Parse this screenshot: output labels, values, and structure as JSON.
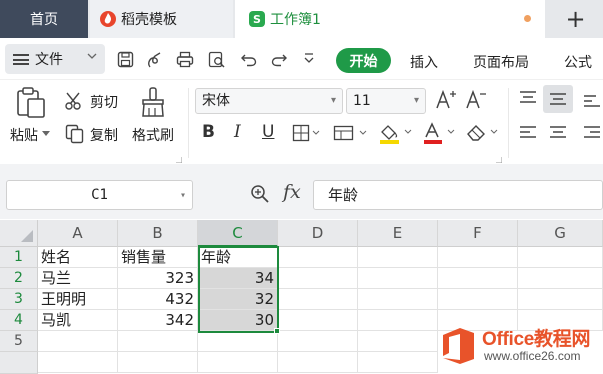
{
  "tabs": {
    "home": "首页",
    "template": "稻壳模板",
    "workbook": "工作簿1",
    "workbook_icon_text": "S",
    "new_tab": "+"
  },
  "menu": {
    "file": "文件",
    "start": "开始",
    "insert": "插入",
    "page_layout": "页面布局",
    "formula": "公式"
  },
  "ribbon": {
    "paste": "粘贴",
    "cut": "剪切",
    "copy": "复制",
    "format_painter": "格式刷",
    "font_name": "宋体",
    "font_size": "11"
  },
  "formula_bar": {
    "cell_ref": "C1",
    "fx": "fx",
    "content": "年龄"
  },
  "sheet": {
    "columns": [
      "A",
      "B",
      "C",
      "D",
      "E",
      "F",
      "G"
    ],
    "selected_column": "C",
    "rows": [
      "1",
      "2",
      "3",
      "4",
      "5"
    ],
    "cells": [
      [
        "姓名",
        "销售量",
        "年龄"
      ],
      [
        "马兰",
        "323",
        "34"
      ],
      [
        "王明明",
        "432",
        "32"
      ],
      [
        "马凯",
        "342",
        "30"
      ]
    ],
    "selected_range": "C1:C4"
  },
  "watermark": {
    "title": "Office教程网",
    "url": "www.office26.com"
  },
  "colors": {
    "accent_green": "#1f9a48",
    "tab_home_bg": "#3f4a5c",
    "selection_border": "#1d8a3d",
    "watermark_orange": "#e8532a"
  }
}
